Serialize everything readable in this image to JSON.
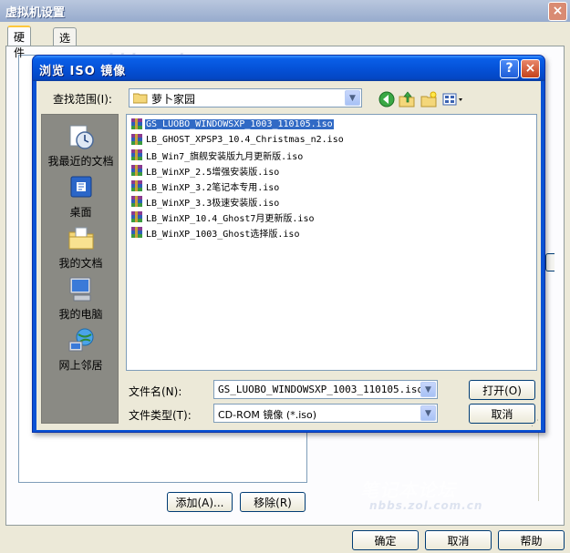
{
  "vm_window": {
    "title": "虚拟机设置",
    "close_glyph": "×",
    "tabs": [
      {
        "label": "硬件"
      },
      {
        "label": "选项"
      }
    ],
    "buttons": {
      "add": "添加(A)...",
      "remove": "移除(R)",
      "ok": "确定",
      "cancel": "取消",
      "help": "帮助"
    },
    "watermarks": [
      "hbbs.zol.com.cn",
      "笔记本论坛",
      "nbbs.zol.com.cn"
    ]
  },
  "iso_dialog": {
    "title": "浏览 ISO 镜像",
    "help_glyph": "?",
    "close_glyph": "×",
    "lookin_label": "查找范围(I):",
    "lookin_value": "萝卜家园",
    "toolbar_icons": [
      "back-icon",
      "up-folder-icon",
      "new-folder-icon",
      "view-menu-icon"
    ],
    "places": [
      {
        "label": "我最近的文档",
        "icon": "recent-documents-icon"
      },
      {
        "label": "桌面",
        "icon": "desktop-icon"
      },
      {
        "label": "我的文档",
        "icon": "my-documents-icon"
      },
      {
        "label": "我的电脑",
        "icon": "my-computer-icon"
      },
      {
        "label": "网上邻居",
        "icon": "network-places-icon"
      }
    ],
    "files": [
      {
        "name": "GS_LUOBO_WINDOWSXP_1003_110105.iso",
        "selected": true
      },
      {
        "name": "LB_GHOST_XPSP3_10.4_Christmas_n2.iso",
        "selected": false
      },
      {
        "name": "LB_Win7_旗舰安装版九月更新版.iso",
        "selected": false
      },
      {
        "name": "LB_WinXP_2.5增强安装版.iso",
        "selected": false
      },
      {
        "name": "LB_WinXP_3.2笔记本专用.iso",
        "selected": false
      },
      {
        "name": "LB_WinXP_3.3极速安装版.iso",
        "selected": false
      },
      {
        "name": "LB_WinXP_10.4_Ghost7月更新版.iso",
        "selected": false
      },
      {
        "name": "LB_WinXP_1003_Ghost选择版.iso",
        "selected": false
      }
    ],
    "filename_label": "文件名(N):",
    "filename_value": "GS_LUOBO_WINDOWSXP_1003_110105.iso",
    "filetype_label": "文件类型(T):",
    "filetype_value": "CD-ROM 镜像 (*.iso)",
    "open_button": "打开(O)",
    "cancel_button": "取消"
  },
  "colors": {
    "titlebar_blue": "#0552d8",
    "selection": "#316ac5",
    "places_bar": "#8a8a84",
    "dialog_face": "#ece9d8"
  }
}
